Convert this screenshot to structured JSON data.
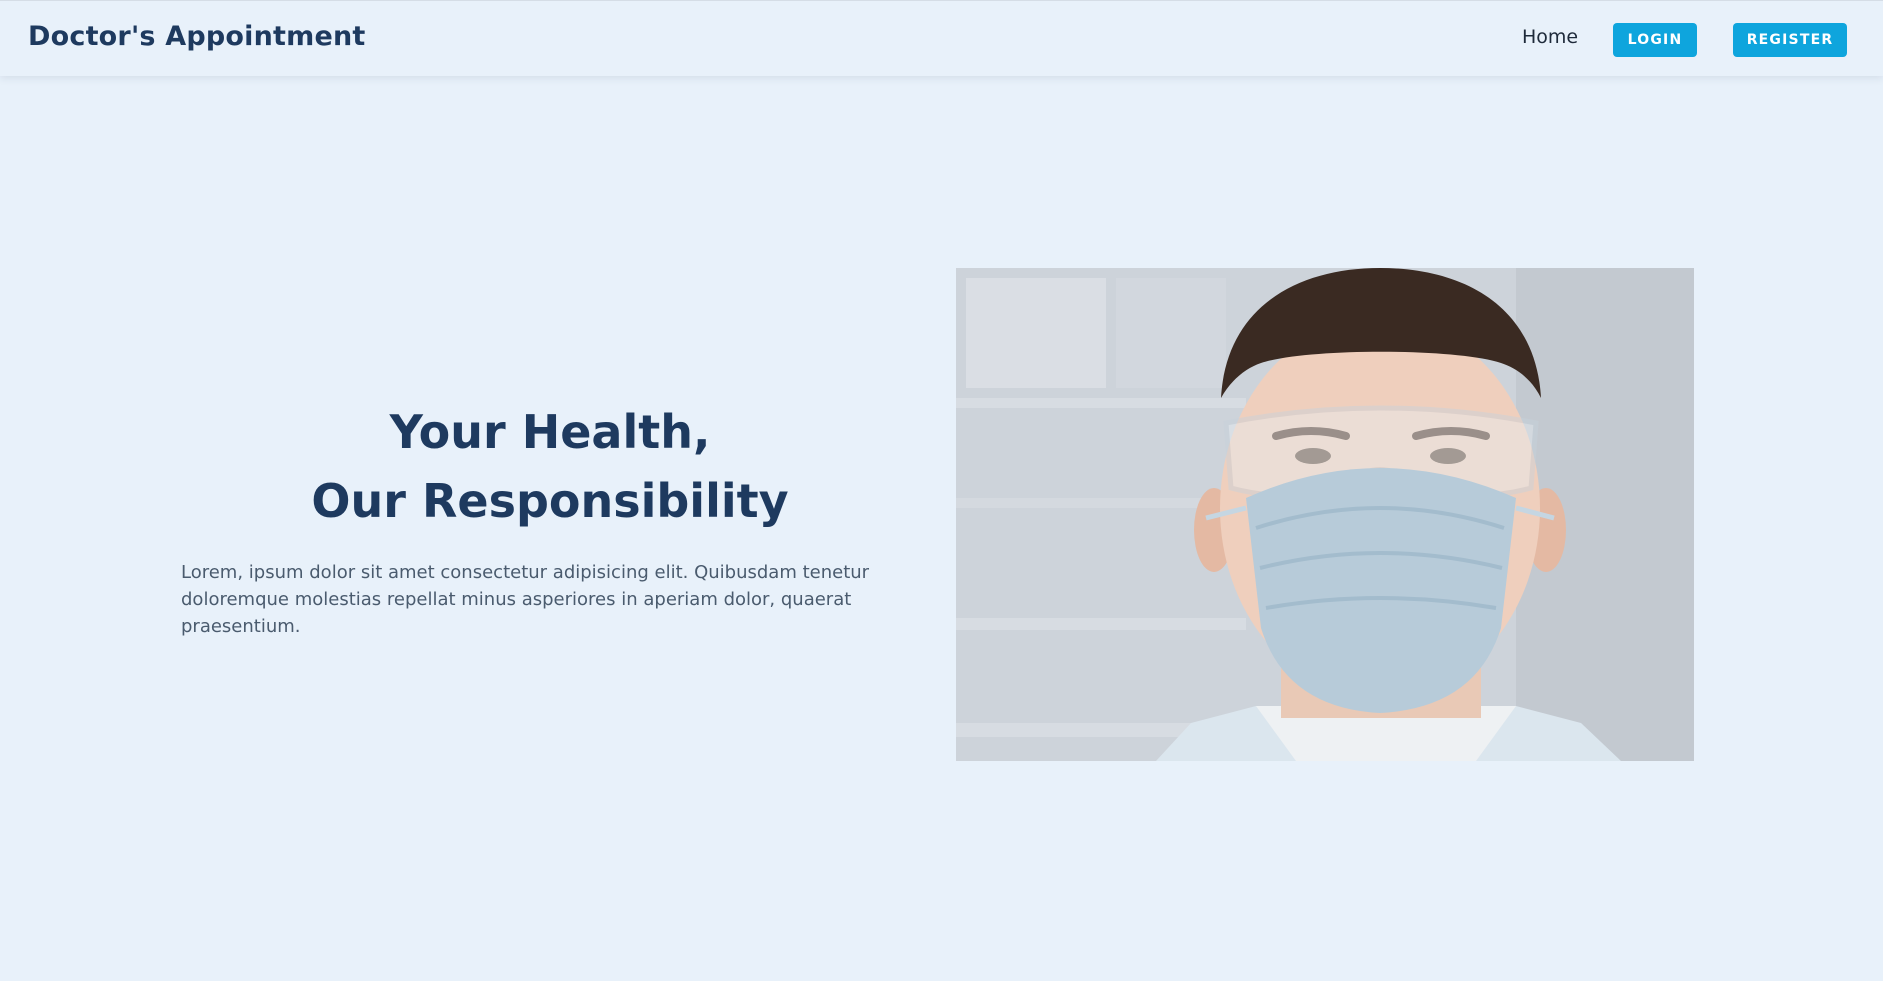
{
  "navbar": {
    "brand": "Doctor's Appointment",
    "home_label": "Home",
    "login_label": "LOGIN",
    "register_label": "REGISTER"
  },
  "hero": {
    "title_line1": "Your Health,",
    "title_line2": "Our Responsibility",
    "description": "Lorem, ipsum dolor sit amet consectetur adipisicing elit. Quibusdam tenetur doloremque molestias repellat minus asperiores in aperiam dolor, quaerat praesentium.",
    "image_icon": "doctor-portrait-photo"
  },
  "colors": {
    "background": "#e8f1fa",
    "brand_text": "#1e3a5f",
    "accent_button": "#0ea5dd",
    "body_text": "#4a5b6e"
  }
}
